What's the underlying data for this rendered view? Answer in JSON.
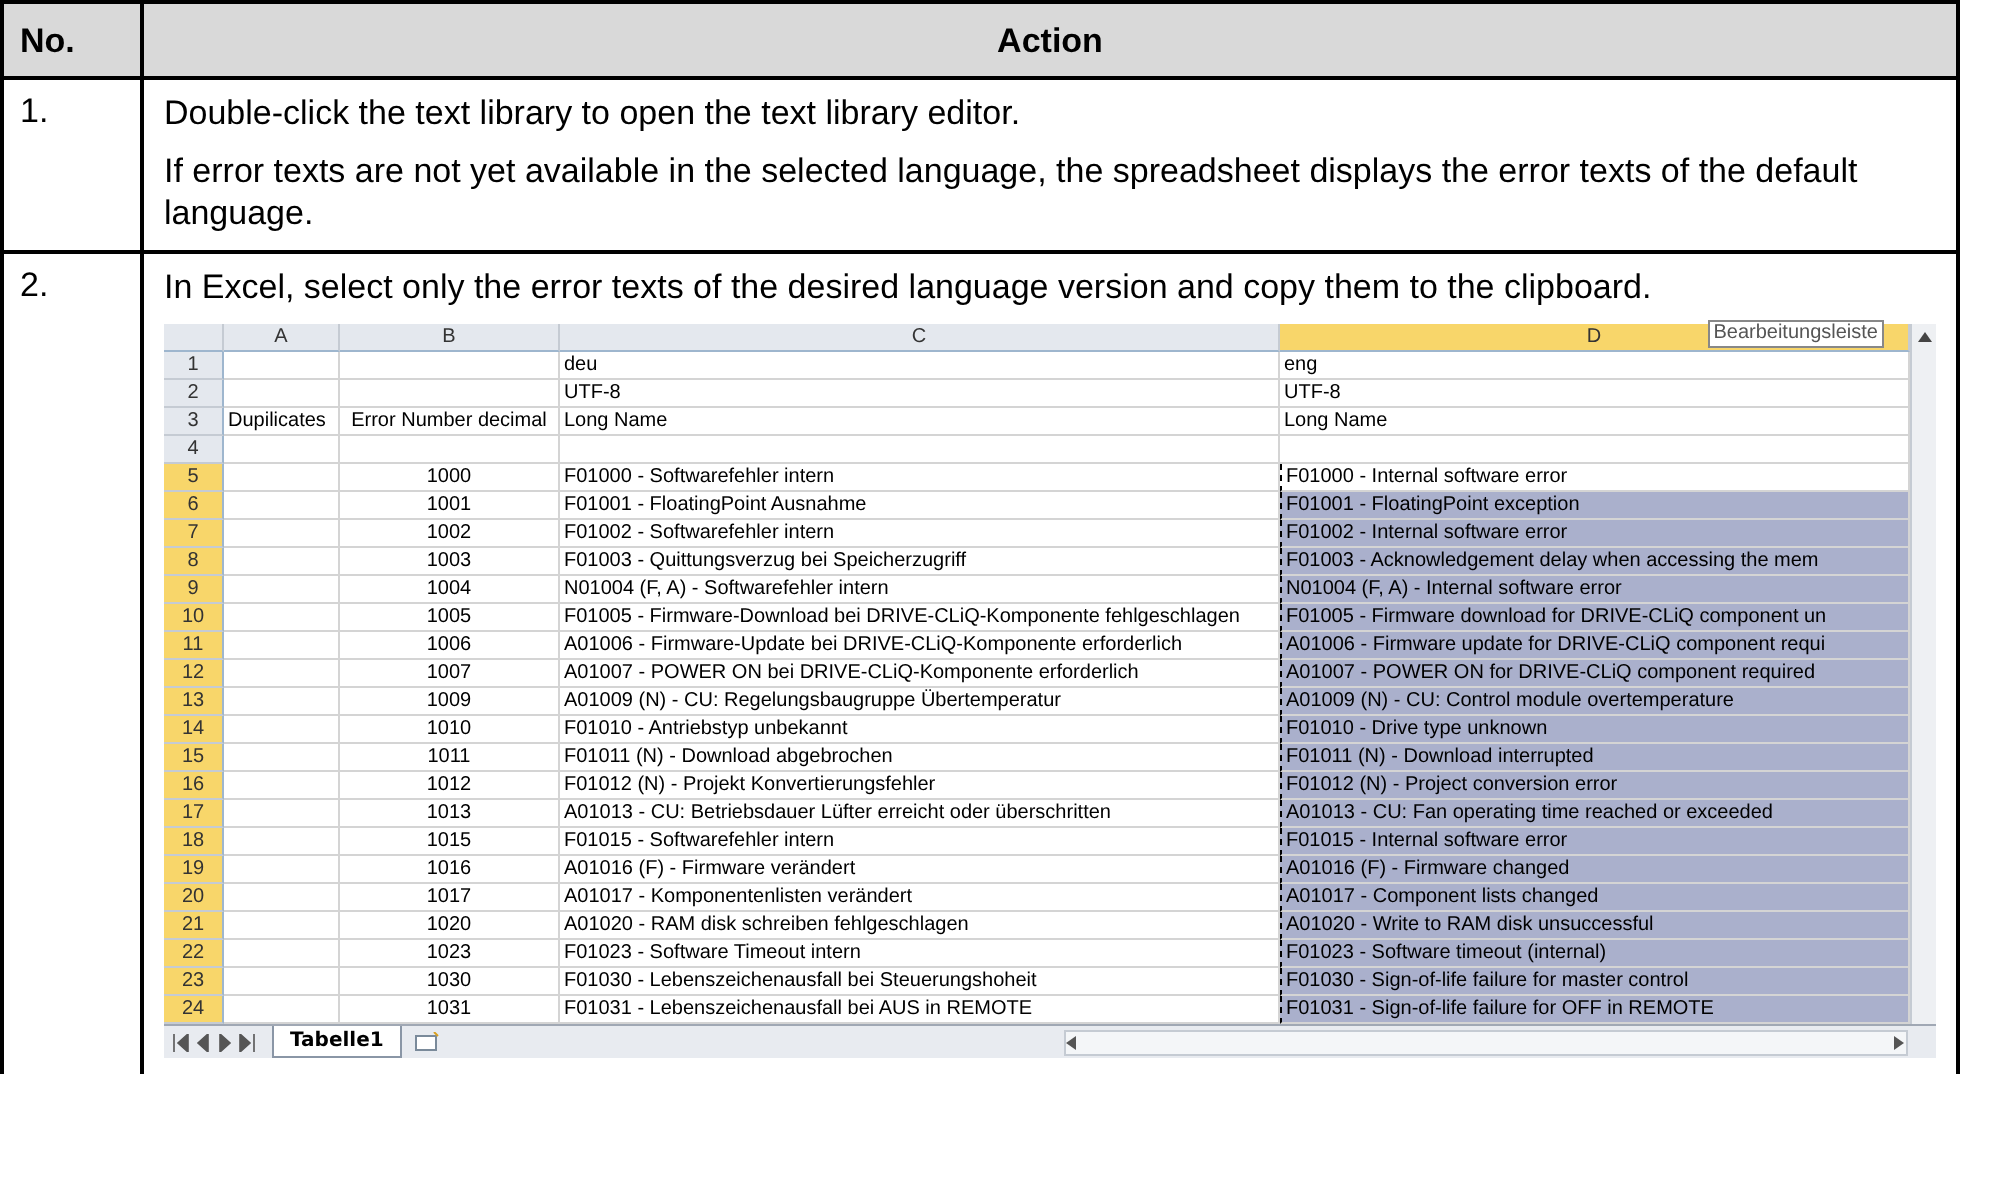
{
  "table": {
    "columns": [
      "No.",
      "Action"
    ],
    "rows": [
      {
        "number": "1.",
        "paragraphs": [
          "Double-click the text library to open the text library editor.",
          "If error texts are not yet available in the selected language, the spreadsheet displays the error texts of the default language."
        ]
      },
      {
        "number": "2.",
        "paragraphs": [
          "In Excel, select only the error texts of the desired language version and copy them to the clipboard."
        ],
        "spreadsheet": {
          "columns": [
            {
              "label": "A",
              "selected": false
            },
            {
              "label": "B",
              "selected": false
            },
            {
              "label": "C",
              "selected": false
            },
            {
              "label": "D",
              "selected": true
            }
          ],
          "tooltip": "Bearbeitungsleiste",
          "rows": [
            {
              "header": "1",
              "selected": false,
              "c": "deu",
              "d": "eng"
            },
            {
              "header": "2",
              "selected": false,
              "c": "UTF-8",
              "d": "UTF-8"
            },
            {
              "header": "3",
              "selected": false,
              "a": "Dupilicates",
              "b": "Error Number decimal",
              "c": "Long Name",
              "d": "Long Name"
            },
            {
              "header": "4",
              "selected": false
            },
            {
              "header": "5",
              "selected": true,
              "active": true,
              "b": "1000",
              "c": "F01000 - Softwarefehler intern",
              "d": "F01000 - Internal software error"
            },
            {
              "header": "6",
              "selected": true,
              "b": "1001",
              "c": "F01001 - FloatingPoint Ausnahme",
              "d": "F01001 - FloatingPoint exception"
            },
            {
              "header": "7",
              "selected": true,
              "b": "1002",
              "c": "F01002 - Softwarefehler intern",
              "d": "F01002 - Internal software error"
            },
            {
              "header": "8",
              "selected": true,
              "b": "1003",
              "c": "F01003 - Quittungsverzug bei Speicherzugriff",
              "d": "F01003 - Acknowledgement delay when accessing the mem"
            },
            {
              "header": "9",
              "selected": true,
              "b": "1004",
              "c": "N01004 (F, A) - Softwarefehler intern",
              "d": "N01004 (F, A) - Internal software error"
            },
            {
              "header": "10",
              "selected": true,
              "b": "1005",
              "c": "F01005 - Firmware-Download bei DRIVE-CLiQ-Komponente fehlgeschlagen",
              "d": "F01005 - Firmware download for DRIVE-CLiQ component un"
            },
            {
              "header": "11",
              "selected": true,
              "b": "1006",
              "c": "A01006 - Firmware-Update bei DRIVE-CLiQ-Komponente erforderlich",
              "d": "A01006 - Firmware update for DRIVE-CLiQ component requi"
            },
            {
              "header": "12",
              "selected": true,
              "b": "1007",
              "c": "A01007 - POWER ON bei DRIVE-CLiQ-Komponente erforderlich",
              "d": "A01007 - POWER ON for DRIVE-CLiQ component required"
            },
            {
              "header": "13",
              "selected": true,
              "b": "1009",
              "c": "A01009 (N) - CU: Regelungsbaugruppe Übertemperatur",
              "d": "A01009 (N) - CU: Control module overtemperature"
            },
            {
              "header": "14",
              "selected": true,
              "b": "1010",
              "c": "F01010 - Antriebstyp unbekannt",
              "d": "F01010 - Drive type unknown"
            },
            {
              "header": "15",
              "selected": true,
              "b": "1011",
              "c": "F01011 (N) - Download abgebrochen",
              "d": "F01011 (N) - Download interrupted"
            },
            {
              "header": "16",
              "selected": true,
              "b": "1012",
              "c": "F01012 (N) - Projekt Konvertierungsfehler",
              "d": "F01012 (N) - Project conversion error"
            },
            {
              "header": "17",
              "selected": true,
              "b": "1013",
              "c": "A01013 - CU: Betriebsdauer Lüfter erreicht oder überschritten",
              "d": "A01013 - CU: Fan operating time reached or exceeded"
            },
            {
              "header": "18",
              "selected": true,
              "b": "1015",
              "c": "F01015 - Softwarefehler intern",
              "d": "F01015 - Internal software error"
            },
            {
              "header": "19",
              "selected": true,
              "b": "1016",
              "c": "A01016 (F) - Firmware verändert",
              "d": "A01016 (F) - Firmware changed"
            },
            {
              "header": "20",
              "selected": true,
              "b": "1017",
              "c": "A01017 - Komponentenlisten verändert",
              "d": "A01017 - Component lists changed"
            },
            {
              "header": "21",
              "selected": true,
              "b": "1020",
              "c": "A01020 - RAM disk schreiben fehlgeschlagen",
              "d": "A01020 - Write to RAM disk unsuccessful"
            },
            {
              "header": "22",
              "selected": true,
              "b": "1023",
              "c": "F01023 - Software Timeout intern",
              "d": "F01023 - Software timeout (internal)"
            },
            {
              "header": "23",
              "selected": true,
              "b": "1030",
              "c": "F01030 - Lebenszeichenausfall bei Steuerungshoheit",
              "d": "F01030 - Sign-of-life failure for master control"
            },
            {
              "header": "24",
              "selected": true,
              "b": "1031",
              "c": "F01031 - Lebenszeichenausfall bei AUS in REMOTE",
              "d": "F01031 - Sign-of-life failure for OFF in REMOTE"
            }
          ],
          "sheet_tabs": [
            {
              "label": "Tabelle1",
              "selected": true
            }
          ]
        }
      }
    ]
  }
}
